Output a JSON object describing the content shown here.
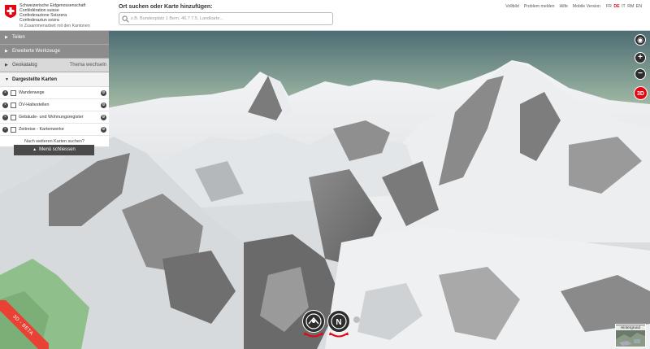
{
  "header": {
    "confederation": [
      "Schweizerische Eidgenossenschaft",
      "Confédération suisse",
      "Confederazione Svizzera",
      "Confederaziun svizra"
    ],
    "cantons_note": "In Zusammenarbeit mit den Kantonen",
    "search_title": "Ort suchen oder Karte hinzufügen:",
    "search_placeholder": "z.B. Bundesplatz 1 Bern, 46.7 7.5, Landkarte...",
    "links": {
      "fullscreen": "Vollbild",
      "report_problem": "Problem melden",
      "help": "Hilfe",
      "mobile_version": "Mobile Version"
    },
    "languages": [
      "FR",
      "DE",
      "IT",
      "RM",
      "EN"
    ],
    "active_language": "DE"
  },
  "panel": {
    "share": "Teilen",
    "advanced_tools": "Erweiterte Werkzeuge",
    "geocatalog": "Geokatalog",
    "change_theme": "Thema wechseln",
    "shown_maps": "Dargestellte Karten",
    "layers": [
      {
        "name": "Wanderwege"
      },
      {
        "name": "ÖV-Haltestellen"
      },
      {
        "name": "Gebäude- und Wohnungsregister"
      },
      {
        "name": "Zeitreise - Kartenwerke"
      }
    ],
    "more_maps": "Nach weiteren Karten suchen?",
    "close_menu": "Menü schliessen"
  },
  "controls": {
    "zoom_in": "+",
    "zoom_out": "−",
    "three_d": "3D",
    "beta_ribbon": "3D - BETA",
    "background_label": "Hintergrund"
  },
  "colors": {
    "brand_red": "#e30613",
    "panel_grey": "#8c8c8c",
    "button_dark": "#2d2d2d"
  }
}
